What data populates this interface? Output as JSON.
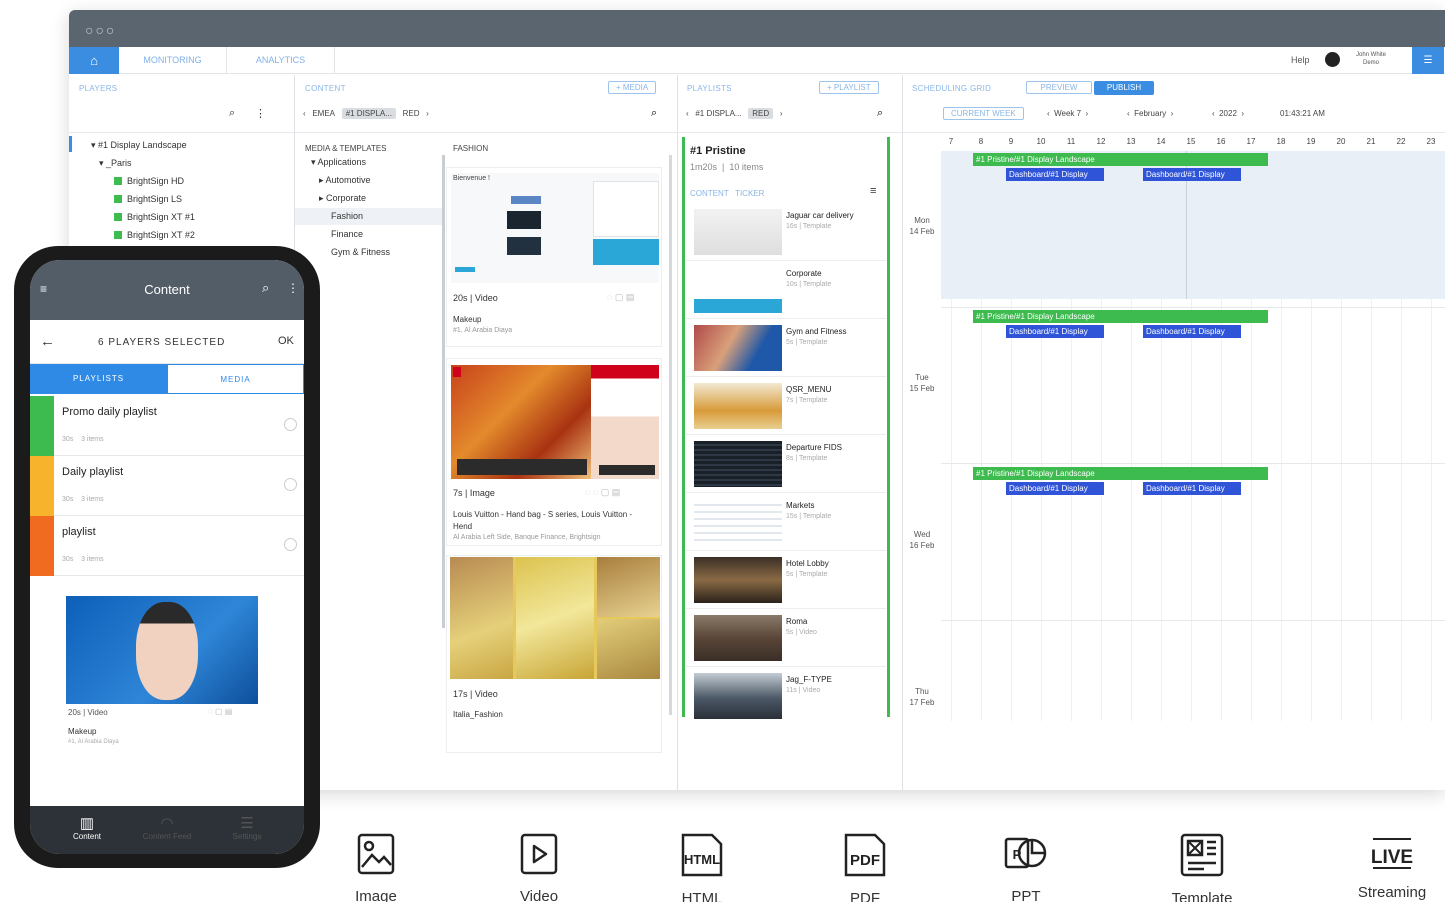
{
  "app": {
    "nav_tabs": [
      "MONITORING",
      "ANALYTICS"
    ],
    "help": "Help",
    "user_name": "John White Demo"
  },
  "players_pane": {
    "header": "PLAYERS",
    "tree": [
      {
        "label": "#1 Display Landscape",
        "level": 0,
        "type": "folder"
      },
      {
        "label": "_Paris",
        "level": 1,
        "type": "folder"
      },
      {
        "label": "BrightSign HD",
        "level": 2,
        "type": "player"
      },
      {
        "label": "BrightSign LS",
        "level": 2,
        "type": "player"
      },
      {
        "label": "BrightSign XT #1",
        "level": 2,
        "type": "player"
      },
      {
        "label": "BrightSign XT #2",
        "level": 2,
        "type": "player"
      }
    ]
  },
  "content_pane": {
    "header": "CONTENT",
    "add_button": "+ MEDIA",
    "crumbs": [
      "EMEA",
      "#1 DISPLA...",
      "RED"
    ],
    "categories_header": "MEDIA & TEMPLATES",
    "folder_title": "FASHION",
    "categories": [
      "Applications",
      "Automotive",
      "Corporate",
      "Fashion",
      "Finance",
      "Gym & Fitness"
    ],
    "cards": [
      {
        "thumb_caption": "Bienvenue !",
        "meta": "20s | Video",
        "title": "Makeup",
        "subtitle": "#1, Al Arabia Diaya"
      },
      {
        "thumb_caption": "",
        "meta": "7s | Image",
        "title": "Louis Vuitton - Hand bag - S series, Louis Vuitton - Hend",
        "subtitle": "Al Arabia Left Side, Banque Finance, Brightsign"
      },
      {
        "thumb_caption": "",
        "meta": "17s | Video",
        "title": "Italia_Fashion",
        "subtitle": ""
      }
    ]
  },
  "playlists_pane": {
    "header": "PLAYLISTS",
    "add_button": "+ PLAYLIST",
    "crumbs": [
      "#1 DISPLA...",
      "RED"
    ],
    "active": {
      "title": "#1 Pristine",
      "duration": "1m20s",
      "items": "10 items",
      "tags": [
        "CONTENT",
        "TICKER"
      ]
    },
    "items": [
      {
        "title": "Jaguar car delivery",
        "meta": "16s | Template"
      },
      {
        "title": "Corporate",
        "meta": "10s | Template"
      },
      {
        "title": "Gym and Fitness",
        "meta": "5s | Template"
      },
      {
        "title": "QSR_MENU",
        "meta": "7s | Template"
      },
      {
        "title": "Departure FIDS",
        "meta": "8s | Template"
      },
      {
        "title": "Markets",
        "meta": "15s | Template"
      },
      {
        "title": "Hotel Lobby",
        "meta": "5s | Template"
      },
      {
        "title": "Roma",
        "meta": "5s | Video"
      },
      {
        "title": "Jag_F-TYPE",
        "meta": "11s | Video"
      }
    ]
  },
  "schedule_pane": {
    "header": "SCHEDULING GRID",
    "preview": "PREVIEW",
    "publish": "PUBLISH",
    "current_week": "CURRENT WEEK",
    "week": "Week 7",
    "month": "February",
    "year": "2022",
    "time": "01:43:21 AM",
    "hours": [
      "7",
      "8",
      "9",
      "10",
      "11",
      "12",
      "13",
      "14",
      "15",
      "16",
      "17",
      "18",
      "19",
      "20",
      "21",
      "22",
      "23"
    ],
    "days": [
      {
        "day": "Mon",
        "date": "14 Feb"
      },
      {
        "day": "Tue",
        "date": "15 Feb"
      },
      {
        "day": "Wed",
        "date": "16 Feb"
      },
      {
        "day": "Thu",
        "date": "17 Feb"
      }
    ],
    "green_event": "#1 Pristine/#1 Display Landscape",
    "blue_event_1": "Dashboard/#1 Display",
    "blue_event_2": "Dashboard/#1 Display"
  },
  "phone": {
    "title": "Content",
    "selected": "6 PLAYERS SELECTED",
    "ok": "OK",
    "tabs": [
      "PLAYLISTS",
      "MEDIA"
    ],
    "playlists": [
      {
        "name": "Promo daily playlist",
        "meta": "30s    3 items",
        "color": "#3dbb4f"
      },
      {
        "name": "Daily playlist",
        "meta": "30s    3 items",
        "color": "#f7b32b"
      },
      {
        "name": "playlist",
        "meta": "30s    3 items",
        "color": "#f06a1f"
      }
    ],
    "media": {
      "meta": "20s | Video",
      "title": "Makeup",
      "subtitle": "#1, Al Arabia Diaya"
    },
    "nav": [
      "Content",
      "Content Feed",
      "Settings"
    ]
  },
  "formats": [
    "Image",
    "Video",
    "HTML",
    "PDF",
    "PPT",
    "Template",
    "Streaming"
  ],
  "format_badges": {
    "html": "HTML",
    "pdf": "PDF",
    "live": "LIVE",
    "ppt": "P"
  },
  "colors": {
    "accent": "#3a8de0",
    "green": "#3dbb4f",
    "blue_event": "#2f54d8",
    "titlebar": "#5b6570"
  }
}
